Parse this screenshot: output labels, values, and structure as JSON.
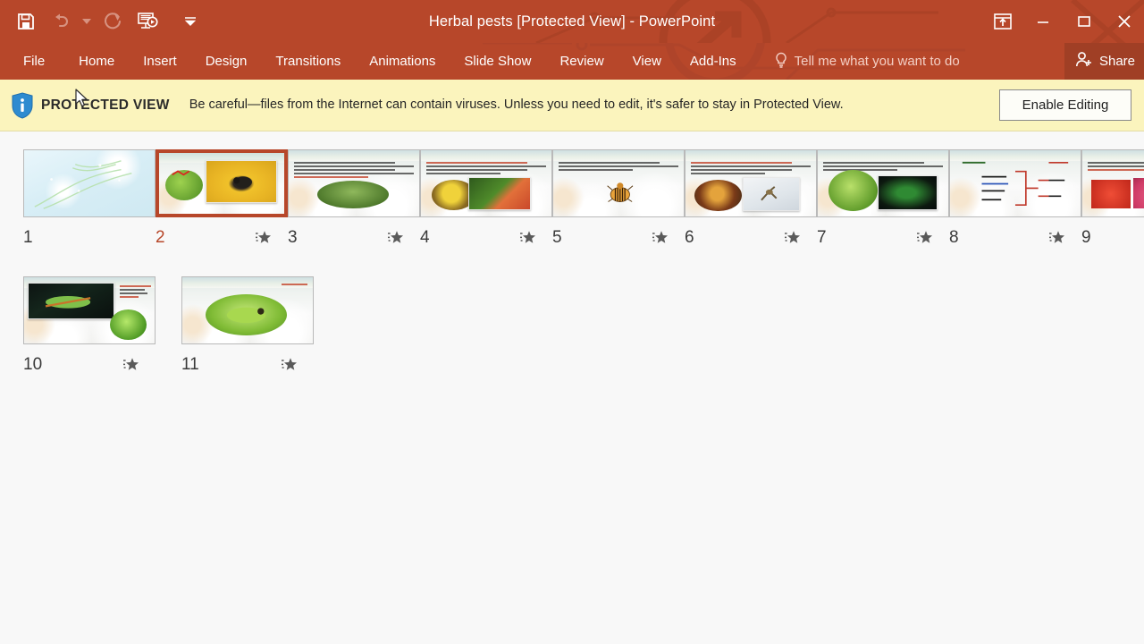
{
  "titlebar": {
    "document_title": "Herbal pests [Protected View] - PowerPoint",
    "accent_color": "#B7472A",
    "quick_access": [
      {
        "name": "save-icon",
        "label": "Save",
        "enabled": true
      },
      {
        "name": "undo-icon",
        "label": "Undo",
        "enabled": false
      },
      {
        "name": "undo-dropdown-icon",
        "label": "Undo options",
        "enabled": false
      },
      {
        "name": "redo-icon",
        "label": "Redo",
        "enabled": false
      },
      {
        "name": "start-from-beginning-icon",
        "label": "Start From Beginning",
        "enabled": true
      },
      {
        "name": "customize-quick-access-toolbar-icon",
        "label": "Customize Quick Access Toolbar",
        "enabled": true
      }
    ],
    "window_controls": [
      {
        "name": "ribbon-display-options-icon",
        "label": "Ribbon Display Options"
      },
      {
        "name": "minimize-icon",
        "label": "Minimize"
      },
      {
        "name": "restore-icon",
        "label": "Restore Down"
      },
      {
        "name": "close-icon",
        "label": "Close"
      }
    ]
  },
  "ribbon": {
    "tabs": [
      {
        "label": "File"
      },
      {
        "label": "Home"
      },
      {
        "label": "Insert"
      },
      {
        "label": "Design"
      },
      {
        "label": "Transitions"
      },
      {
        "label": "Animations"
      },
      {
        "label": "Slide Show"
      },
      {
        "label": "Review"
      },
      {
        "label": "View"
      },
      {
        "label": "Add-Ins"
      }
    ],
    "tell_me": "Tell me what you want to do",
    "share_label": "Share"
  },
  "protected_view": {
    "badge": "PROTECTED VIEW",
    "message": "Be careful—files from the Internet can contain viruses. Unless you need to edit, it's safer to stay in Protected View.",
    "button_label": "Enable Editing",
    "background_color": "#FBF4BD"
  },
  "slide_sorter": {
    "selected_slide": 2,
    "slides": [
      {
        "number": "1",
        "has_animation_star": false,
        "style": "title",
        "selected": false
      },
      {
        "number": "2",
        "has_animation_star": true,
        "style": "two-photo-yellow",
        "selected": true
      },
      {
        "number": "3",
        "has_animation_star": true,
        "style": "oval-field",
        "selected": false
      },
      {
        "number": "4",
        "has_animation_star": true,
        "style": "two-photo-pepper",
        "selected": false
      },
      {
        "number": "5",
        "has_animation_star": true,
        "style": "single-beetle",
        "selected": false
      },
      {
        "number": "6",
        "has_animation_star": true,
        "style": "two-photo-moth",
        "selected": false
      },
      {
        "number": "7",
        "has_animation_star": true,
        "style": "two-photo-green",
        "selected": false
      },
      {
        "number": "8",
        "has_animation_star": true,
        "style": "diagram",
        "selected": false
      },
      {
        "number": "9",
        "has_animation_star": true,
        "style": "two-photo-red",
        "selected": false
      },
      {
        "number": "10",
        "has_animation_star": true,
        "style": "photo-plus-oval",
        "selected": false
      },
      {
        "number": "11",
        "has_animation_star": true,
        "style": "oval-caterpillar",
        "selected": false
      }
    ]
  },
  "workspace": {
    "background_color": "#F8F8F8"
  }
}
